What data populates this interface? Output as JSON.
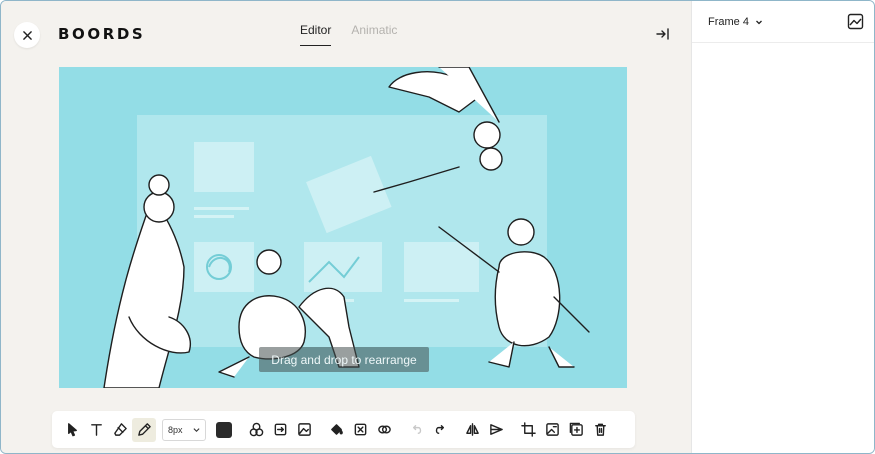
{
  "app": {
    "logo": "BOORDS"
  },
  "header": {
    "tabs": [
      {
        "label": "Editor",
        "active": true
      },
      {
        "label": "Animatic",
        "active": false
      }
    ]
  },
  "canvas": {
    "background": "#93dde6",
    "hint": "Drag and drop to rearrange"
  },
  "toolbar": {
    "brush_size": "8px",
    "color": "#2b2b2b",
    "tools": [
      "pointer-icon",
      "text-icon",
      "eraser-icon",
      "pencil-icon",
      "shapes-icon",
      "frame-icon",
      "image-icon",
      "fill-icon",
      "clear-icon",
      "blend-icon",
      "undo-icon",
      "redo-icon",
      "flip-horizontal-icon",
      "flip-vertical-icon",
      "crop-icon",
      "replace-image-icon",
      "add-frame-icon",
      "delete-icon"
    ]
  },
  "sidebar": {
    "frame_title": "Frame 4"
  }
}
